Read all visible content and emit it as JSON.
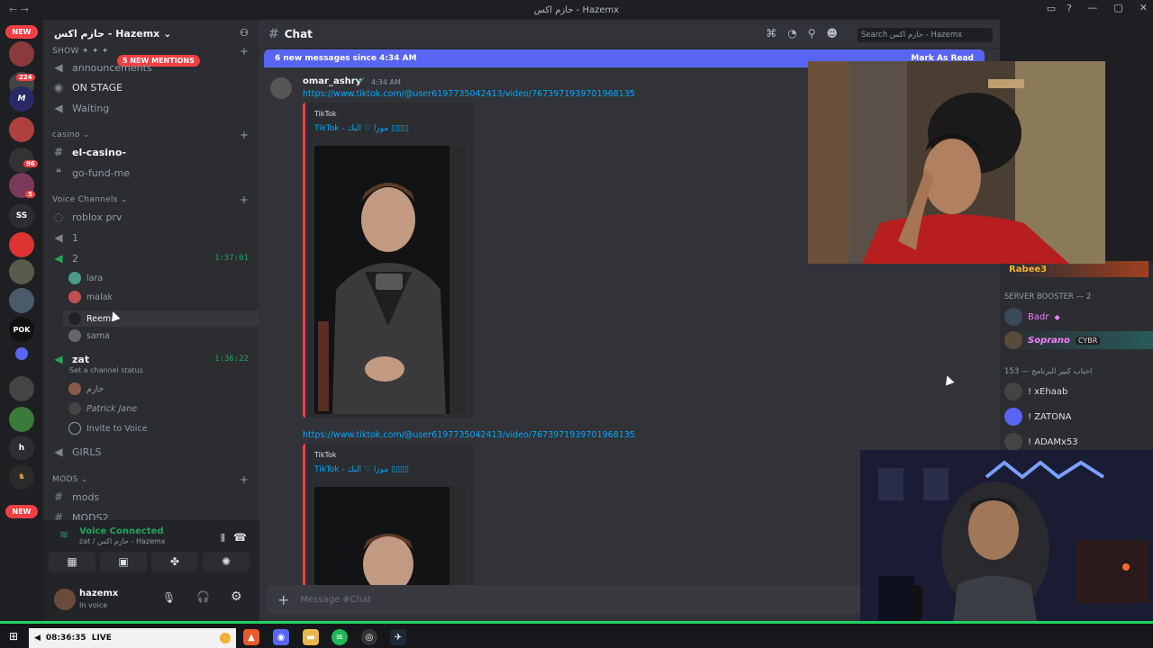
{
  "window": {
    "title": "حازم اكس - Hazemx"
  },
  "servers": {
    "new_top": "NEW",
    "new_bottom": "NEW",
    "badges": [
      "224",
      "96",
      "5"
    ],
    "labels": [
      "SS",
      "h"
    ]
  },
  "server_header": {
    "name": "حازم اكس - Hazemx"
  },
  "mentions_pill": "5 NEW MENTIONS",
  "sidebar": {
    "show_label": "SHOW",
    "channels_top": [
      "announcements",
      "ON STAGE",
      "Waiting"
    ],
    "casino_cat": "casino",
    "casino_channels": [
      "el-casino-",
      "go-fund-me"
    ],
    "voice_cat": "Voice Channels",
    "voice_channels": [
      "roblox prv",
      "1",
      "2"
    ],
    "channel2_timer": "1:37:01",
    "channel2_users": [
      "lara",
      "malak",
      "Reem",
      "sama"
    ],
    "zat": "zat",
    "zat_status": "Set a channel status",
    "zat_timer": "1:36:22",
    "zat_users": [
      "حازم",
      "Patrick Jane"
    ],
    "invite": "Invite to Voice",
    "girls": "GIRLS",
    "mods_cat": "MODS",
    "mods_channels": [
      "mods",
      "MODS2"
    ]
  },
  "voice_panel": {
    "title": "Voice Connected",
    "sub": "zat / حازم اكس - Hazemx"
  },
  "user_panel": {
    "name": "hazemx",
    "status": "In voice"
  },
  "chat": {
    "channel": "Chat",
    "search_placeholder": "Search حازم اكس - Hazemx",
    "new_messages": "6 new messages since 4:34 AM",
    "mark_read": "Mark As Read",
    "author": "omar_ashry",
    "time": "4:34 AM",
    "link": "https://www.tiktok.com/@user6197735042413/video/7673971939701968135",
    "embed_provider": "TikTok",
    "embed_title": "TikTok - موزا ♡ البك ▯▯▯▯",
    "composer_placeholder": "Message #Chat"
  },
  "members": {
    "top_member": "Rabee3",
    "booster_cat": "SERVER BOOSTER — 2",
    "boosters": [
      "Badr",
      "Soprano"
    ],
    "soprano_tag": "CYBR",
    "fans_cat": "احباب كبير البرنامج — 153",
    "fans": [
      "! xEhaab",
      "! ZATONA",
      "! ADAMx53"
    ]
  },
  "taskbar": {
    "time": "08:36:35",
    "live": "LIVE"
  }
}
